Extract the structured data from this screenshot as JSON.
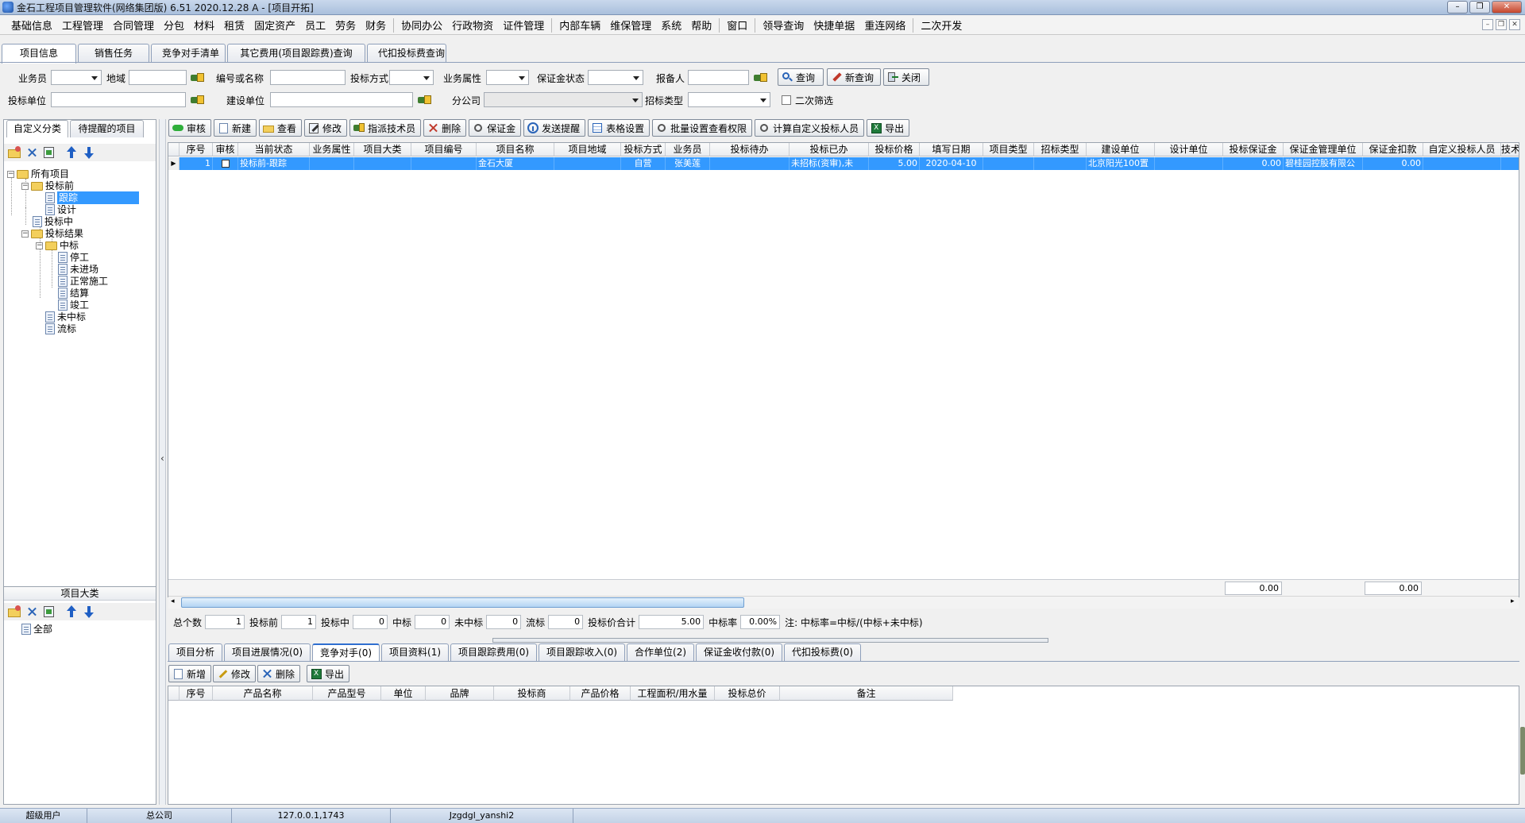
{
  "window": {
    "title": "金石工程项目管理软件(网络集团版) 6.51  2020.12.28 A - [项目开拓]"
  },
  "menu": [
    "基础信息",
    "工程管理",
    "合同管理",
    "分包",
    "材料",
    "租赁",
    "固定资产",
    "员工",
    "劳务",
    "财务",
    "协同办公",
    "行政物资",
    "证件管理",
    "内部车辆",
    "维保管理",
    "系统",
    "帮助",
    "窗口",
    "领导查询",
    "快捷单据",
    "重连网络",
    "二次开发"
  ],
  "main_tabs": [
    "项目信息",
    "销售任务",
    "竞争对手清单",
    "其它费用(项目跟踪费)查询",
    "代扣投标费查询"
  ],
  "filters": {
    "salesman": "业务员",
    "region": "地域",
    "code_or_name": "编号或名称",
    "bid_method": "投标方式",
    "business_attr": "业务属性",
    "deposit_status": "保证金状态",
    "reporter": "报备人",
    "bid_unit": "投标单位",
    "construction_unit": "建设单位",
    "branch": "分公司",
    "tender_type": "招标类型",
    "secondary_filter": "二次筛选",
    "query_btn": "查询",
    "new_query_btn": "新查询",
    "close_btn": "关闭"
  },
  "left_panel": {
    "tabs": [
      "自定义分类",
      "待提醒的项目"
    ],
    "tree": {
      "root": "所有项目",
      "pre_bid": "投标前",
      "tracking": "跟踪",
      "design": "设计",
      "bidding": "投标中",
      "result": "投标结果",
      "won": "中标",
      "stopped": "停工",
      "not_entered": "未进场",
      "normal": "正常施工",
      "settled": "结算",
      "completed": "竣工",
      "lost": "未中标",
      "aborted": "流标"
    },
    "category_header": "项目大类",
    "category_all": "全部"
  },
  "toolbar": [
    "审核",
    "新建",
    "查看",
    "修改",
    "指派技术员",
    "删除",
    "保证金",
    "发送提醒",
    "表格设置",
    "批量设置查看权限",
    "计算自定义投标人员",
    "导出"
  ],
  "grid": {
    "columns": [
      "序号",
      "审核",
      "当前状态",
      "业务属性",
      "项目大类",
      "项目编号",
      "项目名称",
      "项目地域",
      "投标方式",
      "业务员",
      "投标待办",
      "投标已办",
      "投标价格",
      "填写日期",
      "项目类型",
      "招标类型",
      "建设单位",
      "设计单位",
      "投标保证金",
      "保证金管理单位",
      "保证金扣款",
      "自定义投标人员",
      "技术"
    ],
    "rows": [
      {
        "index": "1",
        "status": "投标前-跟踪",
        "project_name": "金石大厦",
        "bid_method": "自营",
        "salesman": "张美莲",
        "done": "未招标(资审),未",
        "price": "5.00",
        "date": "2020-04-10",
        "construction_unit": "北京阳光100置",
        "deposit": "0.00",
        "deposit_unit": "碧桂园控股有限公",
        "deduction": "0.00"
      }
    ],
    "footer_deposit": "0.00",
    "footer_deduction": "0.00"
  },
  "summary": {
    "total_label": "总个数",
    "total": "1",
    "pre_label": "投标前",
    "pre": "1",
    "during_label": "投标中",
    "during": "0",
    "won_label": "中标",
    "won": "0",
    "lost_label": "未中标",
    "lost": "0",
    "abort_label": "流标",
    "abort": "0",
    "price_label": "投标价合计",
    "price": "5.00",
    "rate_label": "中标率",
    "rate": "0.00%",
    "note": "注: 中标率=中标/(中标+未中标)"
  },
  "bottom_tabs": [
    "项目分析",
    "项目进展情况(0)",
    "竞争对手(0)",
    "项目资料(1)",
    "项目跟踪费用(0)",
    "项目跟踪收入(0)",
    "合作单位(2)",
    "保证金收付款(0)",
    "代扣投标费(0)"
  ],
  "bottom_toolbar": [
    "新增",
    "修改",
    "删除",
    "导出"
  ],
  "bottom_grid_columns": [
    "序号",
    "产品名称",
    "产品型号",
    "单位",
    "品牌",
    "投标商",
    "产品价格",
    "工程面积/用水量",
    "投标总价",
    "备注"
  ],
  "statusbar": [
    "超级用户",
    "总公司",
    "127.0.0.1,1743",
    "Jzgdgl_yanshi2"
  ],
  "colors": {
    "selection": "#3399ff",
    "accent": "#2f6fd0"
  }
}
